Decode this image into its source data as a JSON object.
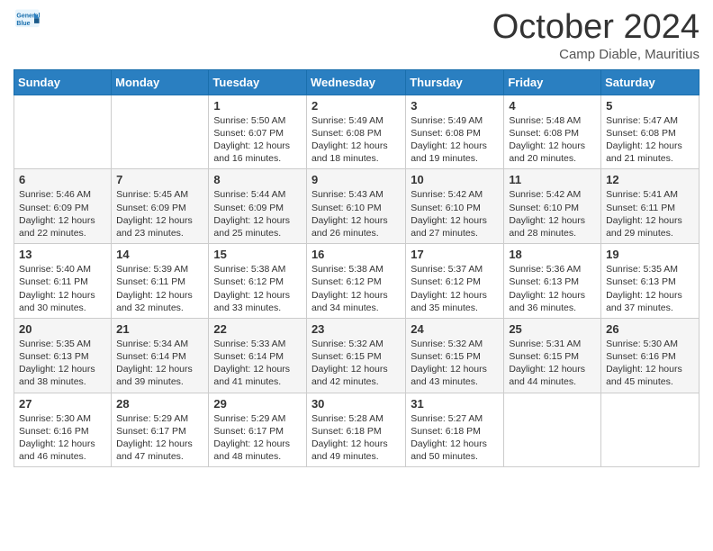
{
  "header": {
    "logo_line1": "General",
    "logo_line2": "Blue",
    "month": "October 2024",
    "location": "Camp Diable, Mauritius"
  },
  "days_of_week": [
    "Sunday",
    "Monday",
    "Tuesday",
    "Wednesday",
    "Thursday",
    "Friday",
    "Saturday"
  ],
  "weeks": [
    [
      {
        "day": "",
        "info": ""
      },
      {
        "day": "",
        "info": ""
      },
      {
        "day": "1",
        "info": "Sunrise: 5:50 AM\nSunset: 6:07 PM\nDaylight: 12 hours and 16 minutes."
      },
      {
        "day": "2",
        "info": "Sunrise: 5:49 AM\nSunset: 6:08 PM\nDaylight: 12 hours and 18 minutes."
      },
      {
        "day": "3",
        "info": "Sunrise: 5:49 AM\nSunset: 6:08 PM\nDaylight: 12 hours and 19 minutes."
      },
      {
        "day": "4",
        "info": "Sunrise: 5:48 AM\nSunset: 6:08 PM\nDaylight: 12 hours and 20 minutes."
      },
      {
        "day": "5",
        "info": "Sunrise: 5:47 AM\nSunset: 6:08 PM\nDaylight: 12 hours and 21 minutes."
      }
    ],
    [
      {
        "day": "6",
        "info": "Sunrise: 5:46 AM\nSunset: 6:09 PM\nDaylight: 12 hours and 22 minutes."
      },
      {
        "day": "7",
        "info": "Sunrise: 5:45 AM\nSunset: 6:09 PM\nDaylight: 12 hours and 23 minutes."
      },
      {
        "day": "8",
        "info": "Sunrise: 5:44 AM\nSunset: 6:09 PM\nDaylight: 12 hours and 25 minutes."
      },
      {
        "day": "9",
        "info": "Sunrise: 5:43 AM\nSunset: 6:10 PM\nDaylight: 12 hours and 26 minutes."
      },
      {
        "day": "10",
        "info": "Sunrise: 5:42 AM\nSunset: 6:10 PM\nDaylight: 12 hours and 27 minutes."
      },
      {
        "day": "11",
        "info": "Sunrise: 5:42 AM\nSunset: 6:10 PM\nDaylight: 12 hours and 28 minutes."
      },
      {
        "day": "12",
        "info": "Sunrise: 5:41 AM\nSunset: 6:11 PM\nDaylight: 12 hours and 29 minutes."
      }
    ],
    [
      {
        "day": "13",
        "info": "Sunrise: 5:40 AM\nSunset: 6:11 PM\nDaylight: 12 hours and 30 minutes."
      },
      {
        "day": "14",
        "info": "Sunrise: 5:39 AM\nSunset: 6:11 PM\nDaylight: 12 hours and 32 minutes."
      },
      {
        "day": "15",
        "info": "Sunrise: 5:38 AM\nSunset: 6:12 PM\nDaylight: 12 hours and 33 minutes."
      },
      {
        "day": "16",
        "info": "Sunrise: 5:38 AM\nSunset: 6:12 PM\nDaylight: 12 hours and 34 minutes."
      },
      {
        "day": "17",
        "info": "Sunrise: 5:37 AM\nSunset: 6:12 PM\nDaylight: 12 hours and 35 minutes."
      },
      {
        "day": "18",
        "info": "Sunrise: 5:36 AM\nSunset: 6:13 PM\nDaylight: 12 hours and 36 minutes."
      },
      {
        "day": "19",
        "info": "Sunrise: 5:35 AM\nSunset: 6:13 PM\nDaylight: 12 hours and 37 minutes."
      }
    ],
    [
      {
        "day": "20",
        "info": "Sunrise: 5:35 AM\nSunset: 6:13 PM\nDaylight: 12 hours and 38 minutes."
      },
      {
        "day": "21",
        "info": "Sunrise: 5:34 AM\nSunset: 6:14 PM\nDaylight: 12 hours and 39 minutes."
      },
      {
        "day": "22",
        "info": "Sunrise: 5:33 AM\nSunset: 6:14 PM\nDaylight: 12 hours and 41 minutes."
      },
      {
        "day": "23",
        "info": "Sunrise: 5:32 AM\nSunset: 6:15 PM\nDaylight: 12 hours and 42 minutes."
      },
      {
        "day": "24",
        "info": "Sunrise: 5:32 AM\nSunset: 6:15 PM\nDaylight: 12 hours and 43 minutes."
      },
      {
        "day": "25",
        "info": "Sunrise: 5:31 AM\nSunset: 6:15 PM\nDaylight: 12 hours and 44 minutes."
      },
      {
        "day": "26",
        "info": "Sunrise: 5:30 AM\nSunset: 6:16 PM\nDaylight: 12 hours and 45 minutes."
      }
    ],
    [
      {
        "day": "27",
        "info": "Sunrise: 5:30 AM\nSunset: 6:16 PM\nDaylight: 12 hours and 46 minutes."
      },
      {
        "day": "28",
        "info": "Sunrise: 5:29 AM\nSunset: 6:17 PM\nDaylight: 12 hours and 47 minutes."
      },
      {
        "day": "29",
        "info": "Sunrise: 5:29 AM\nSunset: 6:17 PM\nDaylight: 12 hours and 48 minutes."
      },
      {
        "day": "30",
        "info": "Sunrise: 5:28 AM\nSunset: 6:18 PM\nDaylight: 12 hours and 49 minutes."
      },
      {
        "day": "31",
        "info": "Sunrise: 5:27 AM\nSunset: 6:18 PM\nDaylight: 12 hours and 50 minutes."
      },
      {
        "day": "",
        "info": ""
      },
      {
        "day": "",
        "info": ""
      }
    ]
  ]
}
